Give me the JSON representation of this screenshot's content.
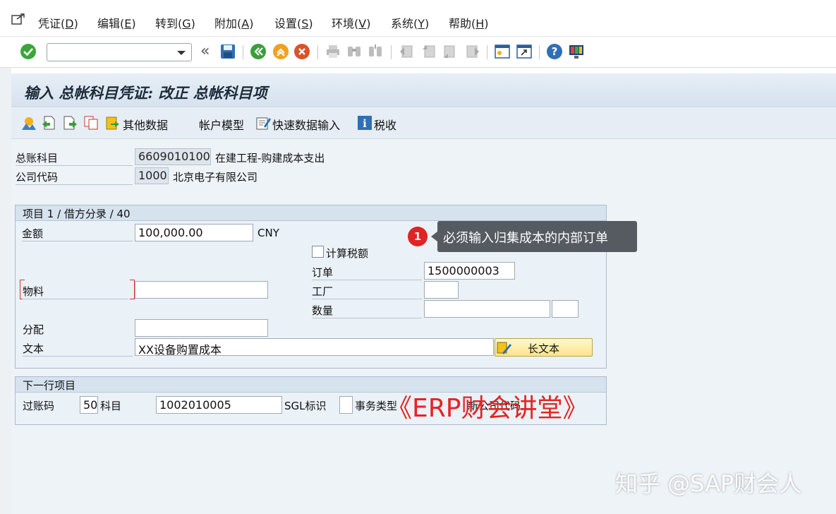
{
  "menu": {
    "items": [
      {
        "label": "凭证(",
        "key": "D",
        "end": ")"
      },
      {
        "label": "编辑(",
        "key": "E",
        "end": ")"
      },
      {
        "label": "转到(",
        "key": "G",
        "end": ")"
      },
      {
        "label": "附加(",
        "key": "A",
        "end": ")"
      },
      {
        "label": "设置(",
        "key": "S",
        "end": ")"
      },
      {
        "label": "环境(",
        "key": "V",
        "end": ")"
      },
      {
        "label": "系统(",
        "key": "Y",
        "end": ")"
      },
      {
        "label": "帮助(",
        "key": "H",
        "end": ")"
      }
    ]
  },
  "toolbar": {
    "command_value": "",
    "back_glyph": "«"
  },
  "screen": {
    "title": "输入 总帐科目凭证: 改正 总帐科目项"
  },
  "app_toolbar": {
    "other_data": "其他数据",
    "account_model": "帐户模型",
    "fast_entry": "快速数据输入",
    "tax": "税收"
  },
  "header": {
    "gl_account_label": "总账科目",
    "gl_account_value": "6609010100",
    "gl_account_desc": "在建工程-购建成本支出",
    "company_code_label": "公司代码",
    "company_code_value": "1000",
    "company_code_desc": "北京电子有限公司"
  },
  "item": {
    "group_title": "项目 1 / 借方分录 / 40",
    "amount_label": "金额",
    "amount_value": "100,000.00",
    "currency": "CNY",
    "calc_tax_label": "计算税额",
    "order_label": "订单",
    "order_value": "1500000003",
    "material_label": "物料",
    "material_value": "",
    "plant_label": "工厂",
    "plant_value": "",
    "quantity_label": "数量",
    "quantity_value": "",
    "unit_value": "",
    "assignment_label": "分配",
    "assignment_value": "",
    "text_label": "文本",
    "text_value": "XX设备购置成本",
    "long_text_button": "长文本"
  },
  "next_item": {
    "group_title": "下一行项目",
    "posting_key_label": "过账码",
    "posting_key_value": "50",
    "account_label": "科目",
    "account_value": "1002010005",
    "sgl_label": "SGL标识",
    "trans_type_label": "事务类型",
    "new_company_label": "新公司代码"
  },
  "annotation": {
    "badge": "1",
    "callout": "必须输入归集成本的内部订单"
  },
  "watermarks": {
    "erp": "《ERP财会讲堂》",
    "zhihu": "知乎 @SAP财会人"
  },
  "colors": {
    "accent_red": "#e02323",
    "title_bg": "#d7e2ee",
    "group_bg": "#eaf1f7"
  }
}
